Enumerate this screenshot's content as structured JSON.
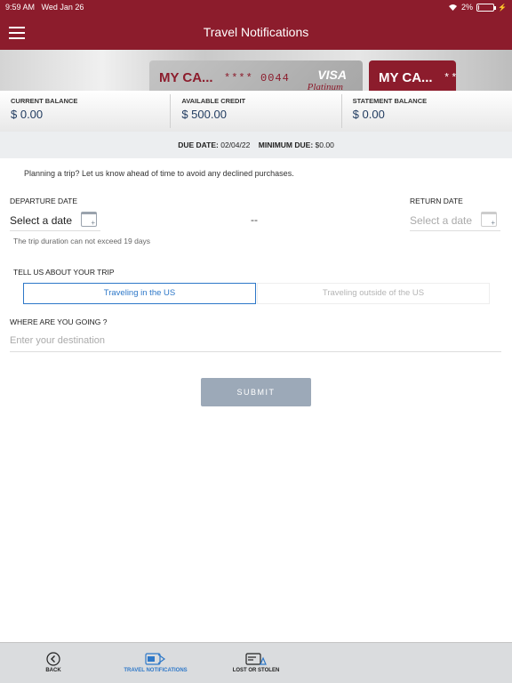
{
  "status_bar": {
    "time": "9:59 AM",
    "date": "Wed Jan 26",
    "battery": "2%",
    "battery_level": 0.02
  },
  "header": {
    "title": "Travel Notifications"
  },
  "cards": [
    {
      "name": "MY CA...",
      "masked_number": "**** 0044",
      "network": "VISA",
      "tier": "Platinum"
    },
    {
      "name": "MY CA...",
      "masked_number": "**"
    }
  ],
  "balances": {
    "current_label": "CURRENT BALANCE",
    "current_value": "$ 0.00",
    "available_label": "AVAILABLE CREDIT",
    "available_value": "$ 500.00",
    "statement_label": "STATEMENT BALANCE",
    "statement_value": "$ 0.00"
  },
  "due": {
    "due_label": "DUE DATE:",
    "due_value": "02/04/22",
    "min_label": "MINIMUM DUE:",
    "min_value": "$0.00"
  },
  "form": {
    "intro": "Planning a trip? Let us know ahead of time to avoid any declined purchases.",
    "departure_label": "DEPARTURE DATE",
    "departure_value": "Select a date",
    "separator": "--",
    "return_label": "RETURN DATE",
    "return_value": "Select a date",
    "duration_hint": "The trip duration can not exceed 19 days",
    "trip_label": "TELL US ABOUT YOUR TRIP",
    "option_us": "Traveling in the US",
    "option_outside": "Traveling outside of the US",
    "destination_label": "WHERE ARE YOU GOING ?",
    "destination_placeholder": "Enter your destination",
    "submit": "SUBMIT"
  },
  "tabs": {
    "back": "BACK",
    "travel": "TRAVEL NOTIFICATIONS",
    "lost": "LOST OR STOLEN"
  },
  "colors": {
    "brand": "#8c1c2c",
    "accent": "#2e78c8",
    "submit": "#9ca9b8"
  }
}
